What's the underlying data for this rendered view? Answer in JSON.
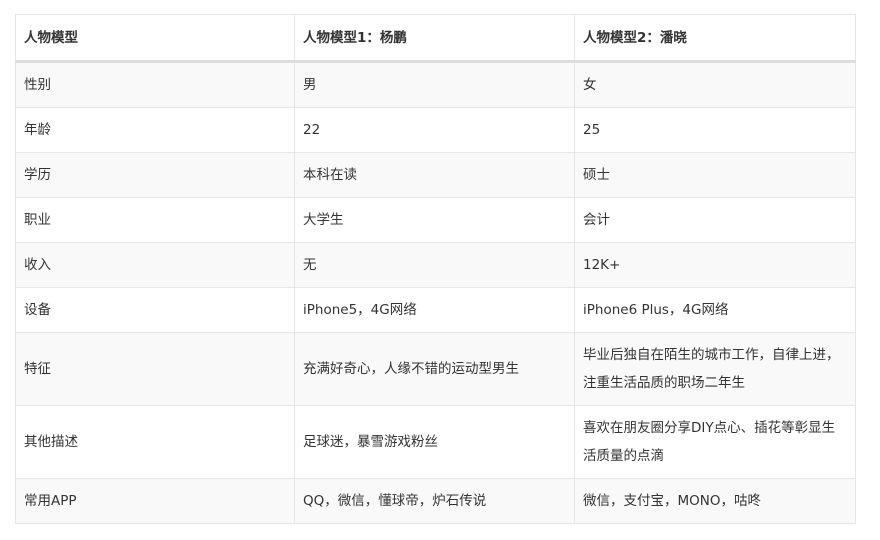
{
  "table": {
    "headers": [
      "人物模型",
      "人物模型1：杨鹏",
      "人物模型2：潘晓"
    ],
    "rows": [
      [
        "性别",
        "男",
        "女"
      ],
      [
        "年龄",
        "22",
        "25"
      ],
      [
        "学历",
        "本科在读",
        "硕士"
      ],
      [
        "职业",
        "大学生",
        "会计"
      ],
      [
        "收入",
        "无",
        "12K+"
      ],
      [
        "设备",
        "iPhone5，4G网络",
        "iPhone6 Plus，4G网络"
      ],
      [
        "特征",
        "充满好奇心，人缘不错的运动型男生",
        "毕业后独自在陌生的城市工作，自律上进，注重生活品质的职场二年生"
      ],
      [
        "其他描述",
        "足球迷，暴雪游戏粉丝",
        "喜欢在朋友圈分享DIY点心、插花等彰显生活质量的点滴"
      ],
      [
        "常用APP",
        "QQ，微信，懂球帝，炉石传说",
        "微信，支付宝，MONO，咕咚"
      ]
    ]
  },
  "colors": {
    "text": "#333333",
    "border": "#e6e6e6",
    "header_rule": "#dddddd",
    "stripe": "#f9f9f9"
  }
}
